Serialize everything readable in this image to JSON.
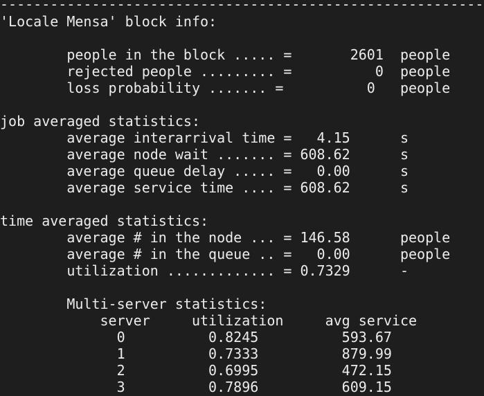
{
  "terminal": {
    "colors": {
      "background": "#1e1e1e",
      "text": "#ececec"
    },
    "lines": [
      "------------------------------------------------------------",
      "'Locale Mensa' block info:",
      "",
      "        people in the block ..... =       2601  people",
      "        rejected people ......... =          0  people",
      "        loss probability ....... =          0   people",
      "",
      "job averaged statistics:",
      "        average interarrival time =   4.15      s",
      "        average node wait ....... = 608.62      s",
      "        average queue delay ..... =   0.00      s",
      "        average service time .... = 608.62      s",
      "",
      "time averaged statistics:",
      "        average # in the node ... = 146.58      people",
      "        average # in the queue .. =   0.00      people",
      "        utilization ............. = 0.7329      -",
      "",
      "        Multi-server statistics:",
      "            server     utilization     avg service",
      "              0          0.8245          593.67",
      "              1          0.7333          879.99",
      "              2          0.6995          472.15",
      "              3          0.7896          609.15"
    ]
  }
}
